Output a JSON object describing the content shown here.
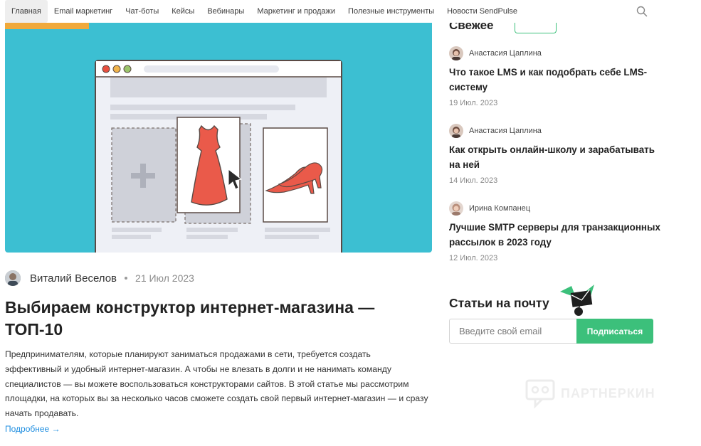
{
  "nav": {
    "items": [
      {
        "label": "Главная",
        "active": true
      },
      {
        "label": "Email маркетинг"
      },
      {
        "label": "Чат-боты"
      },
      {
        "label": "Кейсы"
      },
      {
        "label": "Вебинары"
      },
      {
        "label": "Маркетинг и продажи"
      },
      {
        "label": "Полезные инструменты"
      },
      {
        "label": "Новости SendPulse"
      }
    ],
    "search_icon": "search-icon"
  },
  "article": {
    "author": "Виталий Веселов",
    "date": "21 Июл 2023",
    "title": "Выбираем конструктор интернет-магазина — ТОП-10",
    "excerpt": "Предпринимателям, которые планируют заниматься продажами в сети, требуется создать эффективный и удобный интернет-магазин. А чтобы не влезать в долги и не нанимать команду специалистов — вы можете воспользоваться конструкторами сайтов. В этой статье мы рассмотрим площадки, на которых вы за несколько часов сможете создать свой первый интернет-магазин — и сразу начать продавать.",
    "read_more": "Подробнее →"
  },
  "sidebar": {
    "heading": "Свежее",
    "posts": [
      {
        "author": "Анастасия Цаплина",
        "title": "Что такое LMS и как подобрать себе LMS-систему",
        "date": "19 Июл. 2023"
      },
      {
        "author": "Анастасия Цаплина",
        "title": "Как открыть онлайн-школу и зарабатывать на ней",
        "date": "14 Июл. 2023"
      },
      {
        "author": "Ирина Компанец",
        "title": "Лучшие SMTP серверы для транзакционных рассылок в 2023 году",
        "date": "12 Июл. 2023"
      }
    ],
    "subscribe": {
      "title": "Статьи на почту",
      "placeholder": "Введите свой email",
      "button": "Подписаться"
    }
  },
  "watermark": "ПАРТНЕРКИН",
  "colors": {
    "accent_green": "#3cc07b",
    "hero_bg": "#3cbfd2",
    "link": "#1f8ee0"
  }
}
